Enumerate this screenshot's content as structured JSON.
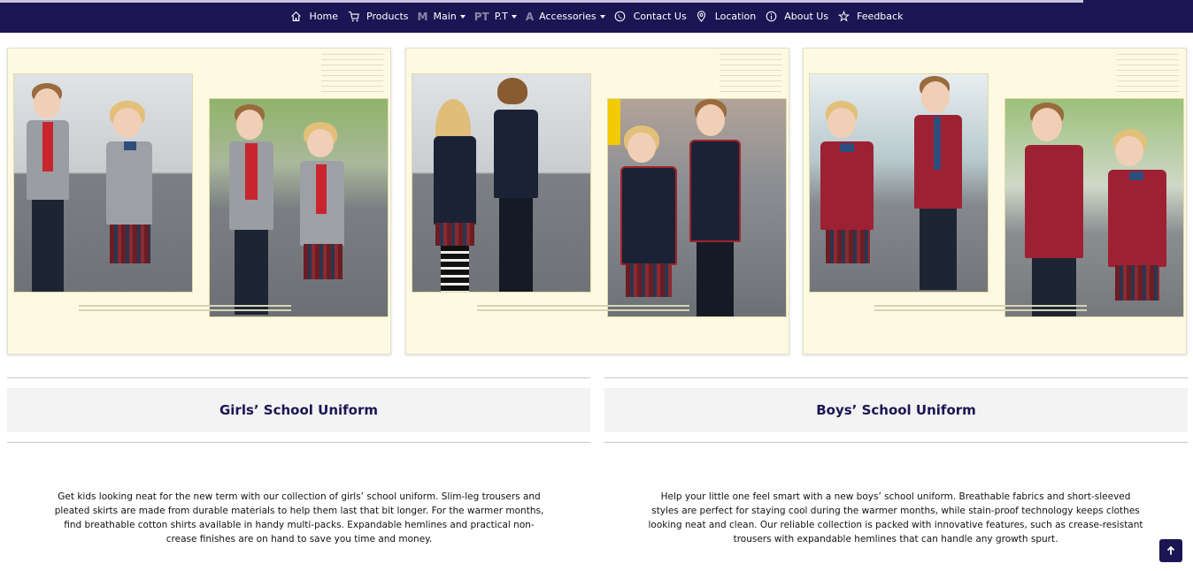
{
  "nav": {
    "items": [
      {
        "label": "Home",
        "icon": "home-icon"
      },
      {
        "label": "Products",
        "icon": "cart-icon"
      },
      {
        "label": "Main",
        "glyph": "M",
        "dropdown": true
      },
      {
        "label": "P.T",
        "glyph": "PT",
        "dropdown": true
      },
      {
        "label": "Accessories",
        "glyph": "A",
        "dropdown": true
      },
      {
        "label": "Contact Us",
        "icon": "phone-icon"
      },
      {
        "label": "Location",
        "icon": "location-pin-icon"
      },
      {
        "label": "About Us",
        "icon": "info-icon"
      },
      {
        "label": "Feedback",
        "icon": "feedback-icon"
      }
    ]
  },
  "colors": {
    "navbar": "#1b1553",
    "heading": "#1b1553",
    "card_bg": "#fdf9e2"
  },
  "sections": [
    {
      "title": "Girls’ School Uniform",
      "description": "Get kids looking neat for the new term with our collection of girls’ school uniform. Slim-leg trousers and pleated skirts are made from durable materials to help them last that bit longer. For the warmer months, find breathable cotton shirts available in handy multi-packs. Expandable hemlines and practical non-crease finishes are on hand to save you time and money."
    },
    {
      "title": "Boys’ School Uniform",
      "description": "Help your little one feel smart with a new boys’ school uniform. Breathable fabrics and short-sleeved styles are perfect for staying cool during the warmer months, while stain-proof technology keeps clothes looking neat and clean. Our reliable collection is packed with innovative features, such as crease-resistant trousers with expandable hemlines that can handle any growth spurt."
    }
  ],
  "back_to_top": {
    "icon": "arrow-up-icon"
  }
}
